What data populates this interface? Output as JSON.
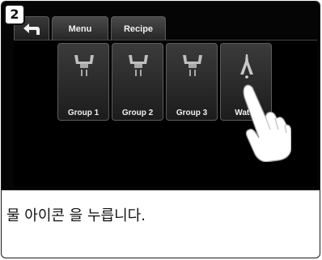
{
  "step": {
    "number": "2"
  },
  "tabs": {
    "menu": "Menu",
    "recipe": "Recipe"
  },
  "tiles": [
    {
      "label": "Group 1",
      "icon": "group-head-icon"
    },
    {
      "label": "Group 2",
      "icon": "group-head-icon"
    },
    {
      "label": "Group 3",
      "icon": "group-head-icon"
    },
    {
      "label": "Water",
      "icon": "water-tap-icon"
    }
  ],
  "instruction": "물 아이콘 을 누릅니다.",
  "colors": {
    "screen_bg": "#050505",
    "tile_bg": "#2c2c2c",
    "text": "#f0f0f0"
  }
}
